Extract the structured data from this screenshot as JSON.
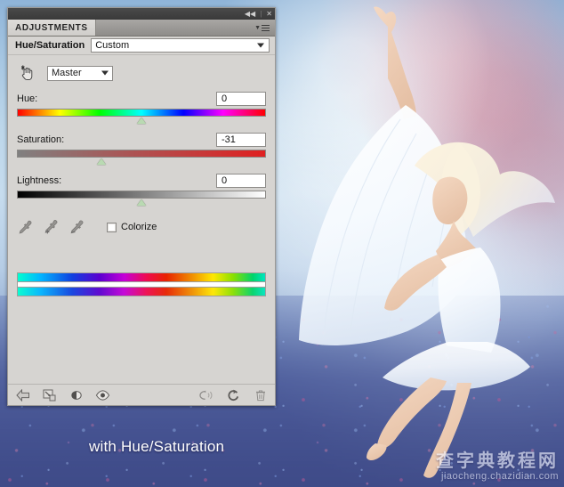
{
  "window": {
    "titlebar": {
      "collapse_label": "◀◀",
      "close_label": "✕"
    }
  },
  "panel": {
    "tab_label": "ADJUSTMENTS",
    "panel_menu_icon": "panel-menu-icon",
    "adjustment_title": "Hue/Saturation",
    "preset": {
      "value": "Custom",
      "placeholder": "Custom"
    },
    "channel": {
      "value": "Master",
      "options_visible": "Master"
    },
    "scrub_tool_icon": "on-image-adjustment-hand-icon",
    "sliders": [
      {
        "label": "Hue:",
        "value": "0",
        "thumb_pct": 50,
        "track": "hue"
      },
      {
        "label": "Saturation:",
        "value": "-31",
        "thumb_pct": 34,
        "track": "saturation"
      },
      {
        "label": "Lightness:",
        "value": "0",
        "thumb_pct": 50,
        "track": "lightness"
      }
    ],
    "eyedroppers": [
      {
        "name": "eyedropper-sample-icon"
      },
      {
        "name": "eyedropper-add-to-sample-icon"
      },
      {
        "name": "eyedropper-subtract-from-sample-icon"
      }
    ],
    "colorize": {
      "label": "Colorize",
      "checked": false
    },
    "footer_buttons": [
      {
        "name": "return-to-adjustment-list-button",
        "icon": "left-arrow-icon"
      },
      {
        "name": "clip-to-layer-button",
        "icon": "clip-to-layer-icon"
      },
      {
        "name": "toggle-layer-visibility-split-button",
        "icon": "half-circle-icon"
      },
      {
        "name": "preview-eye-button",
        "icon": "eye-icon"
      },
      {
        "name": "view-previous-state-button",
        "icon": "previous-state-icon"
      },
      {
        "name": "reset-adjustment-button",
        "icon": "reset-circular-arrow-icon"
      },
      {
        "name": "delete-adjustment-layer-button",
        "icon": "trash-icon"
      }
    ]
  },
  "caption": {
    "text": "with Hue/Saturation"
  },
  "watermark": {
    "cn": "查字典教程网",
    "en": "jiaocheng.chazidian.com"
  },
  "colors": {
    "panel_bg": "#d6d4d1",
    "titlebar": "#3a3a3a",
    "slider_thumb": "#b9dab2",
    "saturation_track_end": "#e02020",
    "caption_text": "#ffffff"
  }
}
